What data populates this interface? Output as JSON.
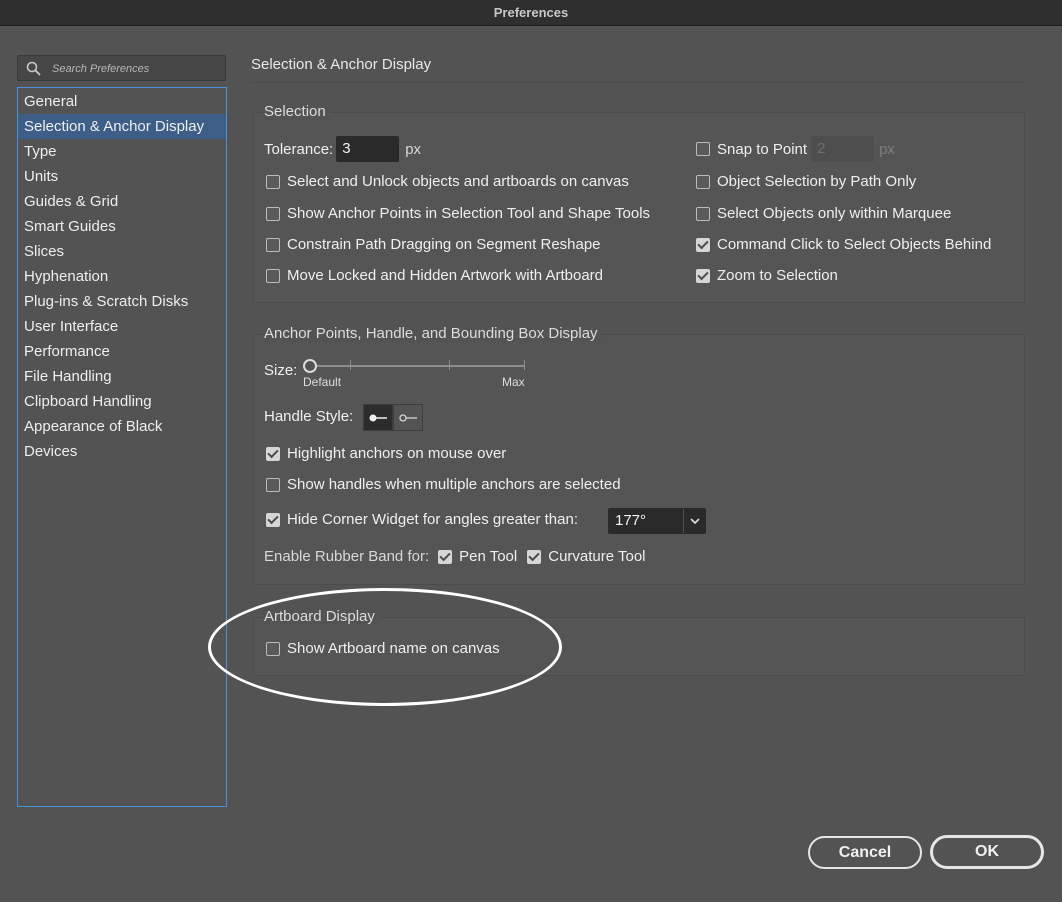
{
  "window": {
    "title": "Preferences"
  },
  "search": {
    "placeholder": "Search Preferences"
  },
  "categories": [
    {
      "label": "General"
    },
    {
      "label": "Selection & Anchor Display",
      "selected": true
    },
    {
      "label": "Type"
    },
    {
      "label": "Units"
    },
    {
      "label": "Guides & Grid"
    },
    {
      "label": "Smart Guides"
    },
    {
      "label": "Slices"
    },
    {
      "label": "Hyphenation"
    },
    {
      "label": "Plug-ins & Scratch Disks"
    },
    {
      "label": "User Interface"
    },
    {
      "label": "Performance"
    },
    {
      "label": "File Handling"
    },
    {
      "label": "Clipboard Handling"
    },
    {
      "label": "Appearance of Black"
    },
    {
      "label": "Devices"
    }
  ],
  "page": {
    "title": "Selection & Anchor Display"
  },
  "selection": {
    "label": "Selection",
    "tolerance_label": "Tolerance:",
    "tolerance_value": "3",
    "tolerance_unit": "px",
    "snap_label": "Snap to Point",
    "snap_value": "2",
    "snap_unit": "px",
    "snap_checked": false,
    "options_left": [
      {
        "label": "Select and Unlock objects and artboards on canvas",
        "checked": false
      },
      {
        "label": "Show Anchor Points in Selection Tool and Shape Tools",
        "checked": false
      },
      {
        "label": "Constrain Path Dragging on Segment Reshape",
        "checked": false
      },
      {
        "label": "Move Locked and Hidden Artwork with Artboard",
        "checked": false
      }
    ],
    "options_right": [
      {
        "label": "Object Selection by Path Only",
        "checked": false
      },
      {
        "label": "Select Objects only within Marquee",
        "checked": false
      },
      {
        "label": "Command Click to Select Objects Behind",
        "checked": true
      },
      {
        "label": "Zoom to Selection",
        "checked": true
      }
    ]
  },
  "anchors": {
    "label": "Anchor Points, Handle, and Bounding Box Display",
    "size_label": "Size:",
    "size_min_label": "Default",
    "size_max_label": "Max",
    "size_level": 0,
    "handle_style_label": "Handle Style:",
    "handle_style_selected": 0,
    "highlight_label": "Highlight anchors on mouse over",
    "highlight_checked": true,
    "show_handles_label": "Show handles when multiple anchors are selected",
    "show_handles_checked": false,
    "hide_corner_label": "Hide Corner Widget for angles greater than:",
    "hide_corner_checked": true,
    "corner_angle": "177°",
    "rubber_band_label": "Enable Rubber Band for:",
    "pen_tool_label": "Pen Tool",
    "pen_tool_checked": true,
    "curvature_tool_label": "Curvature Tool",
    "curvature_tool_checked": true
  },
  "artboard": {
    "label": "Artboard Display",
    "show_name_label": "Show Artboard name on canvas",
    "show_name_checked": false
  },
  "buttons": {
    "cancel": "Cancel",
    "ok": "OK"
  },
  "colors": {
    "background": "#535353",
    "selection_highlight": "#3d5f87",
    "list_border": "#4a90d9",
    "annotation": "#ffffff"
  }
}
